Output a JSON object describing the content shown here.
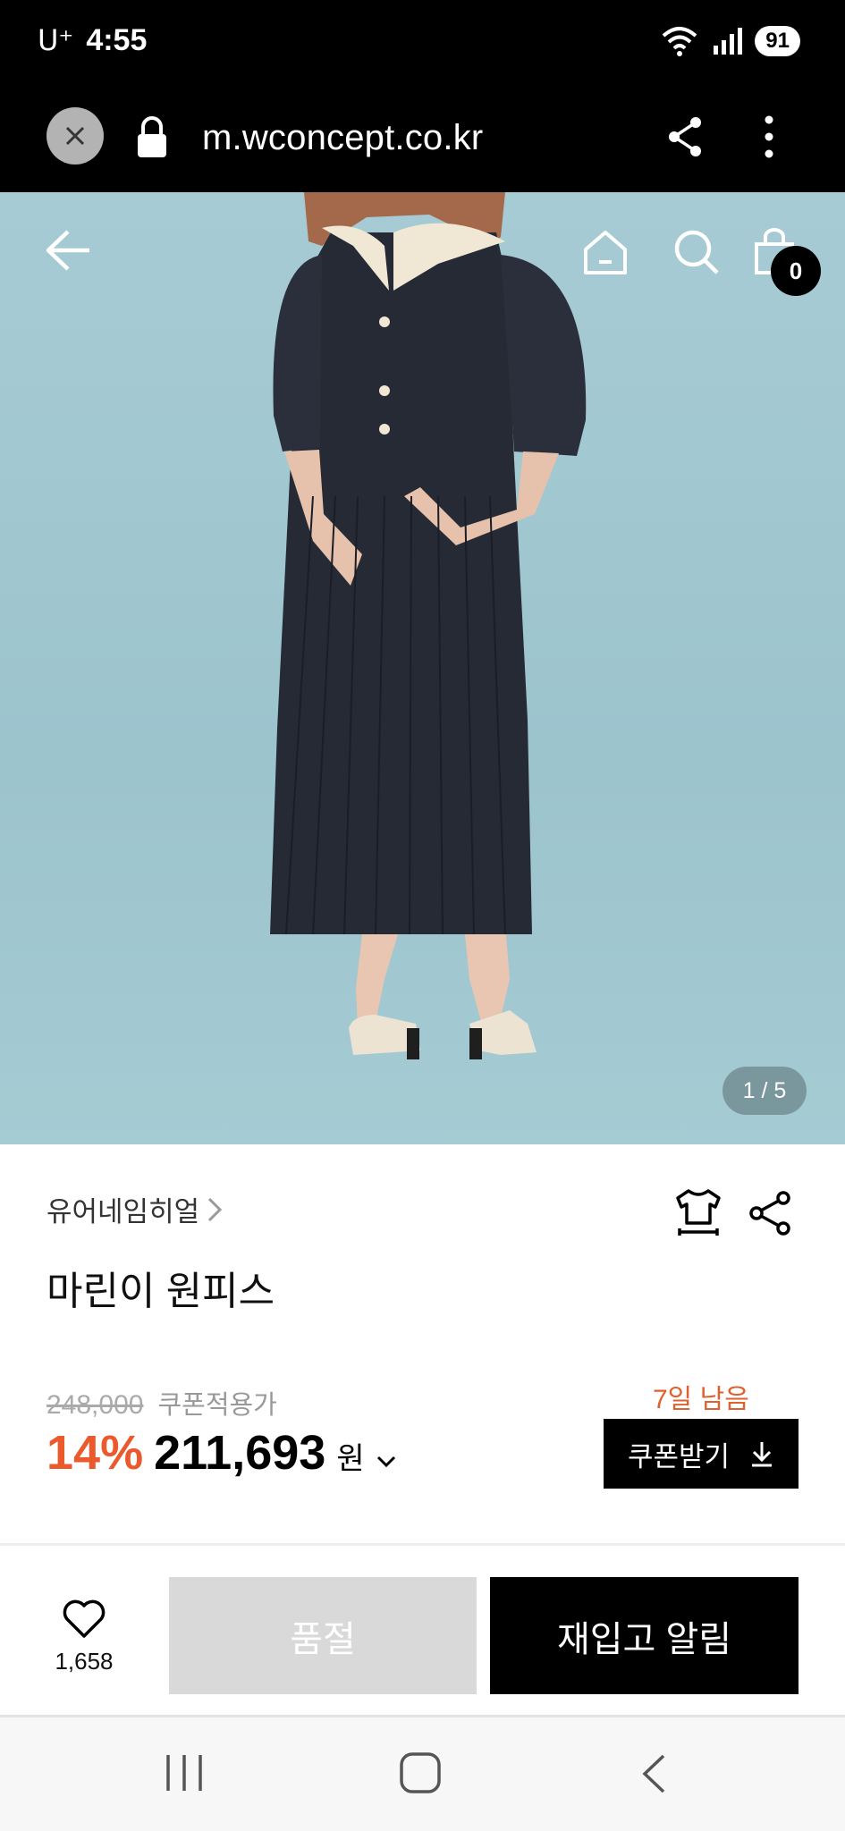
{
  "status_bar": {
    "carrier": "U⁺",
    "time": "4:55",
    "battery": "91"
  },
  "browser": {
    "url": "m.wconcept.co.kr"
  },
  "hero": {
    "counter": "1 / 5",
    "cart_count": "0"
  },
  "product": {
    "brand": "유어네임히얼",
    "name": "마린이 원피스",
    "original_price": "248,000",
    "coupon_label": "쿠폰적용가",
    "discount": "14%",
    "price": "211,693",
    "currency": "원",
    "days_left": "7일 남음",
    "coupon_button": "쿠폰받기"
  },
  "actions": {
    "like_count": "1,658",
    "soldout_label": "품절",
    "restock_label": "재입고 알림"
  },
  "colors": {
    "accent": "#ea5a2d",
    "hero_bg": "#a7cbd4"
  }
}
